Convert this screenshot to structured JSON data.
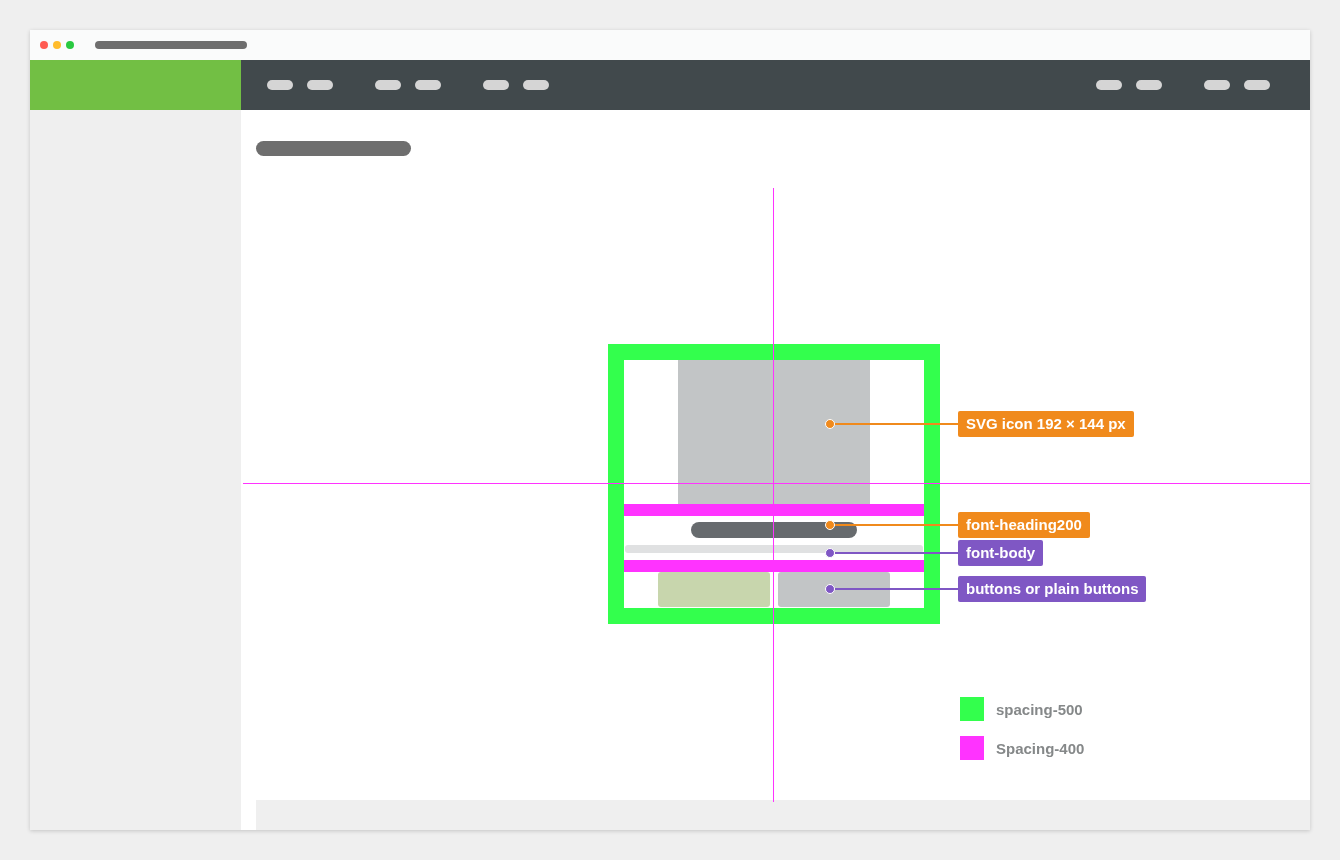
{
  "annotations": [
    {
      "label": "SVG icon 192 × 144 px",
      "color": "#f08a1c"
    },
    {
      "label": "font-heading200",
      "color": "#f08a1c"
    },
    {
      "label": "font-body",
      "color": "#7f57c4"
    },
    {
      "label": "buttons or plain buttons",
      "color": "#7f57c4"
    }
  ],
  "legend": [
    {
      "label": "spacing-500",
      "color": "#33ff4d"
    },
    {
      "label": "Spacing-400",
      "color": "#ff33ff"
    }
  ]
}
